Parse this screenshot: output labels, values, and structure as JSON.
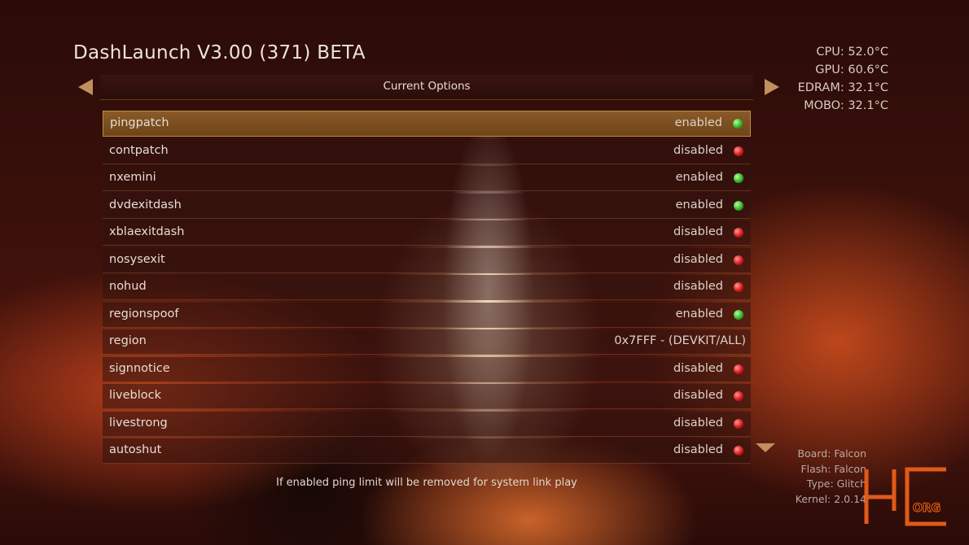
{
  "app": {
    "title": "DashLaunch V3.00 (371) BETA"
  },
  "temps": [
    "CPU: 52.0°C",
    "GPU: 60.6°C",
    "EDRAM: 32.1°C",
    "MOBO: 32.1°C"
  ],
  "header": {
    "label": "Current Options"
  },
  "options": [
    {
      "name": "pingpatch",
      "value": "enabled",
      "led": "green"
    },
    {
      "name": "contpatch",
      "value": "disabled",
      "led": "red"
    },
    {
      "name": "nxemini",
      "value": "enabled",
      "led": "green"
    },
    {
      "name": "dvdexitdash",
      "value": "enabled",
      "led": "green"
    },
    {
      "name": "xblaexitdash",
      "value": "disabled",
      "led": "red"
    },
    {
      "name": "nosysexit",
      "value": "disabled",
      "led": "red"
    },
    {
      "name": "nohud",
      "value": "disabled",
      "led": "red"
    },
    {
      "name": "regionspoof",
      "value": "enabled",
      "led": "green"
    },
    {
      "name": "region",
      "value": "0x7FFF - (DEVKIT/ALL)",
      "led": ""
    },
    {
      "name": "signnotice",
      "value": "disabled",
      "led": "red"
    },
    {
      "name": "liveblock",
      "value": "disabled",
      "led": "red"
    },
    {
      "name": "livestrong",
      "value": "disabled",
      "led": "red"
    },
    {
      "name": "autoshut",
      "value": "disabled",
      "led": "red"
    }
  ],
  "selected_index": 0,
  "description": "If enabled ping limit will be removed for system link play",
  "sysinfo": [
    "Board: Falcon",
    "Flash: Falcon",
    "Type: Glitch",
    "Kernel: 2.0.14"
  ],
  "logo": {
    "text": "ORG",
    "color": "#e05a18"
  },
  "icons": {
    "prev": "triangle-left-icon",
    "next": "triangle-right-icon",
    "more": "triangle-down-icon",
    "status": "status-led-icon"
  }
}
